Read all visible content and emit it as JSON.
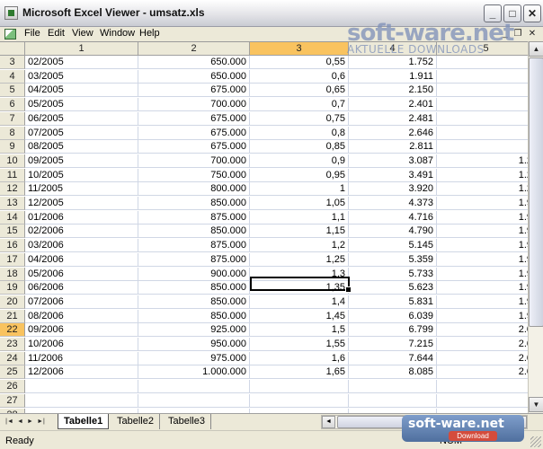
{
  "window": {
    "title": "Microsoft Excel Viewer - umsatz.xls",
    "minimize_glyph": "_",
    "maximize_glyph": "□",
    "close_glyph": "✕"
  },
  "menu": {
    "items": [
      "File",
      "Edit",
      "View",
      "Window",
      "Help"
    ],
    "mdi_min": "_",
    "mdi_restore": "❐",
    "mdi_close": "✕"
  },
  "grid": {
    "columns": [
      "1",
      "2",
      "3",
      "4",
      "5"
    ],
    "selected_column": "3",
    "selected_row": "22",
    "rows": [
      {
        "n": "3",
        "c1": "02/2005",
        "c2": "650.000",
        "c3": "0,55",
        "c4": "1.752",
        "c5": ""
      },
      {
        "n": "4",
        "c1": "03/2005",
        "c2": "650.000",
        "c3": "0,6",
        "c4": "1.911",
        "c5": ""
      },
      {
        "n": "5",
        "c1": "04/2005",
        "c2": "675.000",
        "c3": "0,65",
        "c4": "2.150",
        "c5": ""
      },
      {
        "n": "6",
        "c1": "05/2005",
        "c2": "700.000",
        "c3": "0,7",
        "c4": "2.401",
        "c5": ""
      },
      {
        "n": "7",
        "c1": "06/2005",
        "c2": "675.000",
        "c3": "0,75",
        "c4": "2.481",
        "c5": ""
      },
      {
        "n": "8",
        "c1": "07/2005",
        "c2": "675.000",
        "c3": "0,8",
        "c4": "2.646",
        "c5": ""
      },
      {
        "n": "9",
        "c1": "08/2005",
        "c2": "675.000",
        "c3": "0,85",
        "c4": "2.811",
        "c5": ""
      },
      {
        "n": "10",
        "c1": "09/2005",
        "c2": "700.000",
        "c3": "0,9",
        "c4": "3.087",
        "c5": "1.2"
      },
      {
        "n": "11",
        "c1": "10/2005",
        "c2": "750.000",
        "c3": "0,95",
        "c4": "3.491",
        "c5": "1.2"
      },
      {
        "n": "12",
        "c1": "11/2005",
        "c2": "800.000",
        "c3": "1",
        "c4": "3.920",
        "c5": "1.2"
      },
      {
        "n": "13",
        "c1": "12/2005",
        "c2": "850.000",
        "c3": "1,05",
        "c4": "4.373",
        "c5": "1.9"
      },
      {
        "n": "14",
        "c1": "01/2006",
        "c2": "875.000",
        "c3": "1,1",
        "c4": "4.716",
        "c5": "1.9"
      },
      {
        "n": "15",
        "c1": "02/2006",
        "c2": "850.000",
        "c3": "1,15",
        "c4": "4.790",
        "c5": "1.9"
      },
      {
        "n": "16",
        "c1": "03/2006",
        "c2": "875.000",
        "c3": "1,2",
        "c4": "5.145",
        "c5": "1.9"
      },
      {
        "n": "17",
        "c1": "04/2006",
        "c2": "875.000",
        "c3": "1,25",
        "c4": "5.359",
        "c5": "1.9"
      },
      {
        "n": "18",
        "c1": "05/2006",
        "c2": "900.000",
        "c3": "1,3",
        "c4": "5.733",
        "c5": "1.9"
      },
      {
        "n": "19",
        "c1": "06/2006",
        "c2": "850.000",
        "c3": "1,35",
        "c4": "5.623",
        "c5": "1.9"
      },
      {
        "n": "20",
        "c1": "07/2006",
        "c2": "850.000",
        "c3": "1,4",
        "c4": "5.831",
        "c5": "1.9"
      },
      {
        "n": "21",
        "c1": "08/2006",
        "c2": "850.000",
        "c3": "1,45",
        "c4": "6.039",
        "c5": "1.9"
      },
      {
        "n": "22",
        "c1": "09/2006",
        "c2": "925.000",
        "c3": "1,5",
        "c4": "6.799",
        "c5": "2.0"
      },
      {
        "n": "23",
        "c1": "10/2006",
        "c2": "950.000",
        "c3": "1,55",
        "c4": "7.215",
        "c5": "2.0"
      },
      {
        "n": "24",
        "c1": "11/2006",
        "c2": "975.000",
        "c3": "1,6",
        "c4": "7.644",
        "c5": "2.0"
      },
      {
        "n": "25",
        "c1": "12/2006",
        "c2": "1.000.000",
        "c3": "1,65",
        "c4": "8.085",
        "c5": "2.0"
      },
      {
        "n": "26",
        "c1": "",
        "c2": "",
        "c3": "",
        "c4": "",
        "c5": ""
      },
      {
        "n": "27",
        "c1": "",
        "c2": "",
        "c3": "",
        "c4": "",
        "c5": ""
      },
      {
        "n": "28",
        "c1": "",
        "c2": "",
        "c3": "",
        "c4": "",
        "c5": ""
      }
    ]
  },
  "tabs": {
    "nav": [
      "|◄",
      "◄",
      "►",
      "►|"
    ],
    "sheets": [
      "Tabelle1",
      "Tabelle2",
      "Tabelle3"
    ],
    "active": "Tabelle1"
  },
  "status": {
    "text": "Ready",
    "num": "NUM"
  },
  "watermark": {
    "top_main": "soft-ware.net",
    "top_sub": "AKTUELLE DOWNLOADS",
    "bottom_main": "soft-ware.net",
    "bottom_sub": "Download"
  },
  "colors": {
    "header_bg": "#ece9d8",
    "selected_header": "#f9c35f",
    "gridline": "#d0d7e5"
  }
}
